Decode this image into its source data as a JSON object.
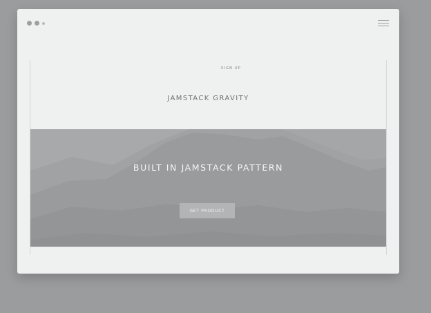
{
  "window": {
    "controls": [
      "close-dot",
      "minimize-dot",
      "maximize-dot"
    ]
  },
  "nav": {
    "items": [
      {
        "label": ""
      },
      {
        "label": ""
      },
      {
        "label": ""
      },
      {
        "label": "SIGN UP"
      }
    ]
  },
  "site": {
    "title": "JAMSTACK GRAVITY",
    "subtitle": ""
  },
  "hero": {
    "title": "BUILT IN JAMSTACK PATTERN",
    "subtitle": "",
    "cta_label": "GET PRODUCT"
  },
  "icons": {
    "menu": "hamburger-icon"
  },
  "colors": {
    "backdrop": "#9a9c9d",
    "window": "#eff0f0",
    "hero": "#9c9e9f",
    "button": "#b2b4b5"
  }
}
